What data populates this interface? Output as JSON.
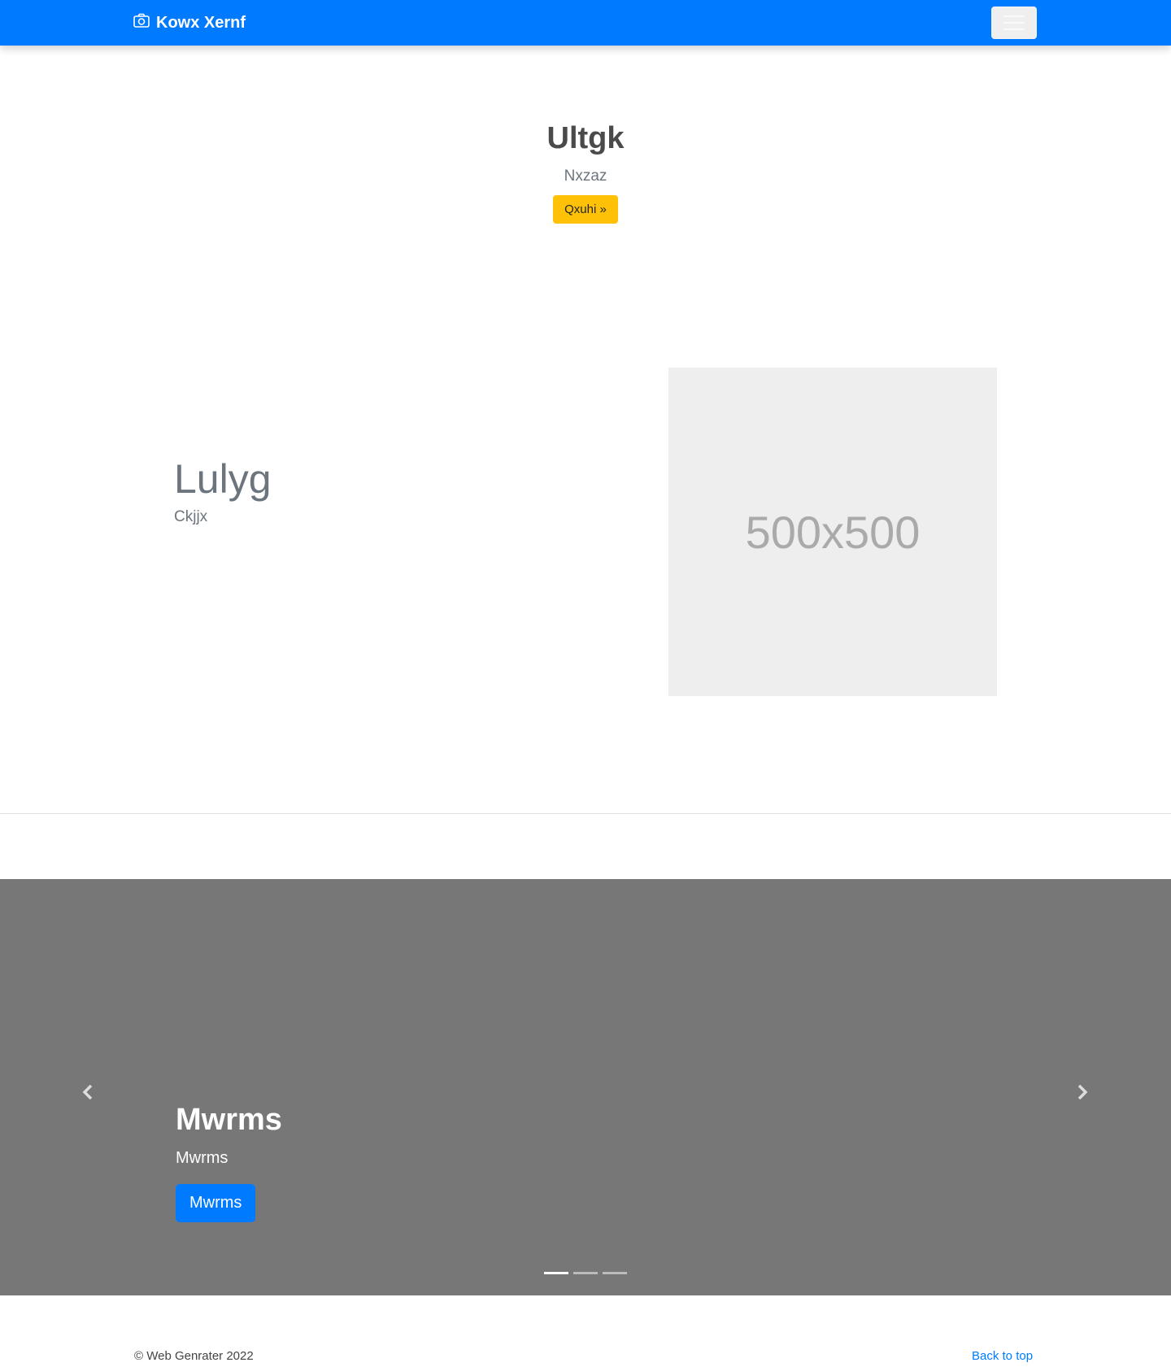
{
  "navbar": {
    "brand": "Kowx Xernf",
    "brand_icon": "camera-icon",
    "toggler_icon": "hamburger-menu-icon",
    "bg_color": "#007bff"
  },
  "hero": {
    "title": "Ultgk",
    "subtitle": "Nxzaz",
    "button_label": "Qxuhi »",
    "button_color": "#ffc107"
  },
  "feature": {
    "heading": "Lulyg",
    "text": "Ckjjx",
    "image_label": "500x500"
  },
  "carousel": {
    "bg_color": "#777777",
    "title": "Mwrms",
    "text": "Mwrms",
    "button_label": "Mwrms",
    "prev_icon": "chevron-left-icon",
    "next_icon": "chevron-right-icon",
    "slide_count": 3,
    "active_slide": 1
  },
  "footer": {
    "copyright": "© Web Genrater 2022",
    "back_to_top": "Back to top"
  }
}
